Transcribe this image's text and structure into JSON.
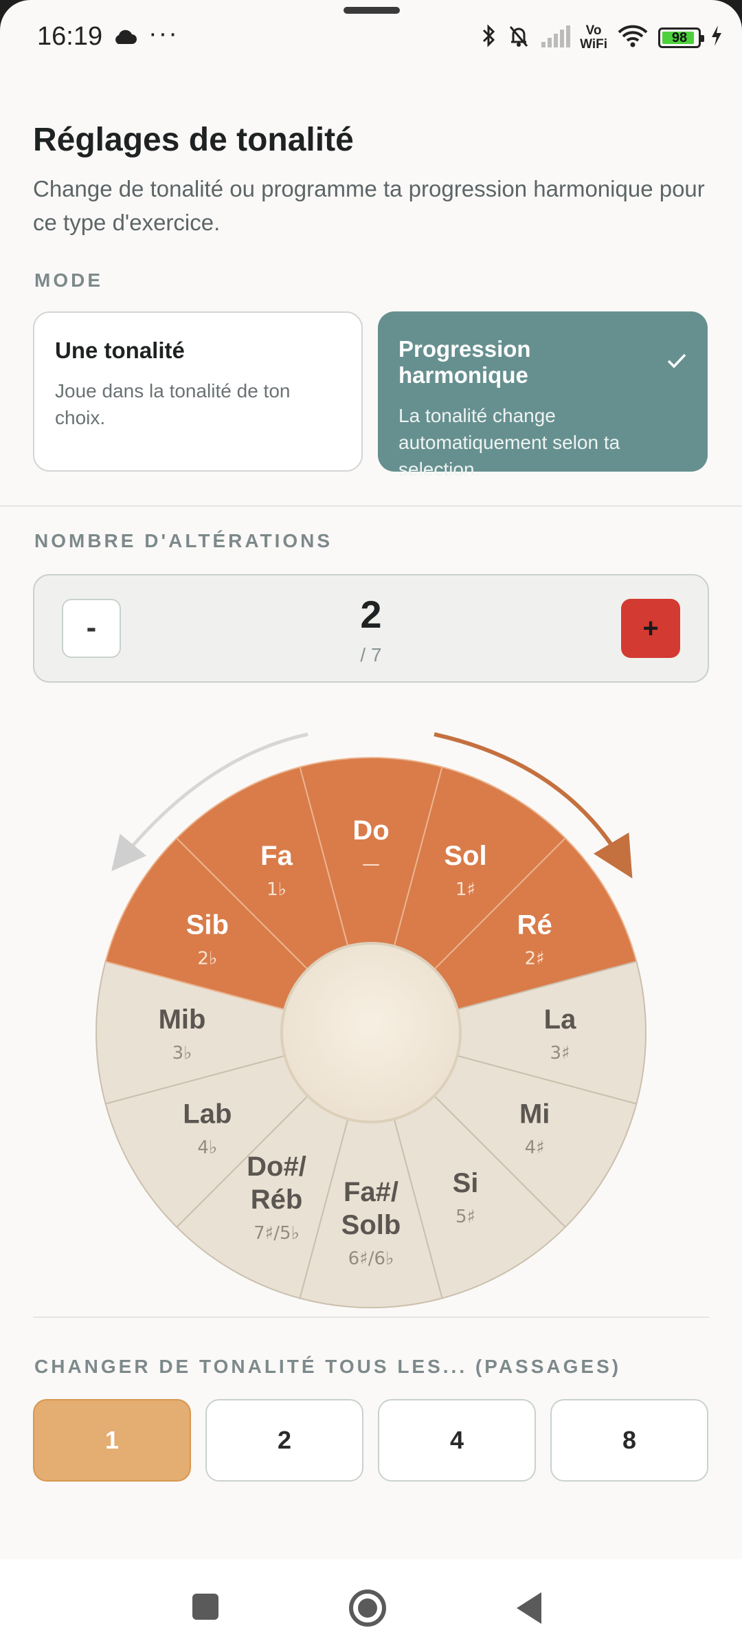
{
  "status_bar": {
    "time": "16:19",
    "overflow": "···",
    "battery": "98",
    "vowifi_top": "Vo",
    "vowifi_bottom": "WiFi"
  },
  "header": {
    "title": "Réglages de tonalité",
    "subtitle": "Change de tonalité ou programme ta progression harmonique pour ce type d'exercice."
  },
  "mode": {
    "label": "MODE",
    "options": [
      {
        "title": "Une tonalité",
        "description": "Joue dans la tonalité de ton choix.",
        "selected": false
      },
      {
        "title": "Progression harmonique",
        "description": "La tonalité change automatiquement selon ta selection.",
        "selected": true
      }
    ]
  },
  "alterations": {
    "label": "NOMBRE D'ALTÉRATIONS",
    "value": "2",
    "max": "/ 7",
    "minus": "-",
    "plus": "+"
  },
  "circle": {
    "active_color": "#d97c4a",
    "inactive_color": "#e9e1d3",
    "keys": [
      {
        "name": [
          "Do"
        ],
        "acc": "—",
        "active": true
      },
      {
        "name": [
          "Sol"
        ],
        "acc": "1♯",
        "active": true
      },
      {
        "name": [
          "Ré"
        ],
        "acc": "2♯",
        "active": true
      },
      {
        "name": [
          "La"
        ],
        "acc": "3♯",
        "active": false
      },
      {
        "name": [
          "Mi"
        ],
        "acc": "4♯",
        "active": false
      },
      {
        "name": [
          "Si"
        ],
        "acc": "5♯",
        "active": false
      },
      {
        "name": [
          "Fa#/",
          "Solb"
        ],
        "acc": "6♯/6♭",
        "active": false
      },
      {
        "name": [
          "Do#/",
          "Réb"
        ],
        "acc": "7♯/5♭",
        "active": false
      },
      {
        "name": [
          "Lab"
        ],
        "acc": "4♭",
        "active": false
      },
      {
        "name": [
          "Mib"
        ],
        "acc": "3♭",
        "active": false
      },
      {
        "name": [
          "Sib"
        ],
        "acc": "2♭",
        "active": true
      },
      {
        "name": [
          "Fa"
        ],
        "acc": "1♭",
        "active": true
      }
    ]
  },
  "frequency": {
    "label": "CHANGER DE TONALITÉ TOUS LES... (PASSAGES)",
    "options": [
      "1",
      "2",
      "4",
      "8"
    ],
    "selected": "1"
  }
}
